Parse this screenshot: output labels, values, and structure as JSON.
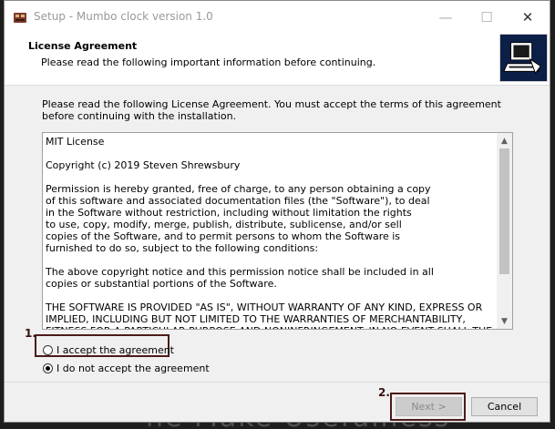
{
  "window": {
    "title": "Setup - Mumbo clock version 1.0",
    "minimize_glyph": "—",
    "maximize_glyph": "☐",
    "close_glyph": "✕"
  },
  "header": {
    "title": "License Agreement",
    "subtitle": "Please read the following important information before continuing."
  },
  "body": {
    "intro": "Please read the following License Agreement. You must accept the terms of this agreement before continuing with the installation.",
    "license_text": "MIT License\n\nCopyright (c) 2019 Steven Shrewsbury\n\nPermission is hereby granted, free of charge, to any person obtaining a copy\nof this software and associated documentation files (the \"Software\"), to deal\nin the Software without restriction, including without limitation the rights\nto use, copy, modify, merge, publish, distribute, sublicense, and/or sell\ncopies of the Software, and to permit persons to whom the Software is\nfurnished to do so, subject to the following conditions:\n\nThe above copyright notice and this permission notice shall be included in all\ncopies or substantial portions of the Software.\n\nTHE SOFTWARE IS PROVIDED \"AS IS\", WITHOUT WARRANTY OF ANY KIND, EXPRESS OR\nIMPLIED, INCLUDING BUT NOT LIMITED TO THE WARRANTIES OF MERCHANTABILITY,\nFITNESS FOR A PARTICULAR PURPOSE AND NONINFRINGEMENT. IN NO EVENT SHALL THE",
    "scroll_up_glyph": "▲",
    "scroll_down_glyph": "▼"
  },
  "options": {
    "accept_label": "I accept the agreement",
    "decline_label": "I do not accept the agreement",
    "selected": "decline"
  },
  "footer": {
    "next_label": "Next >",
    "next_enabled": false,
    "cancel_label": "Cancel"
  },
  "annotations": {
    "label_1": "1.",
    "label_2": "2.",
    "highlight_color": "#4d1a1a"
  },
  "watermark": "ne Make Usefulness"
}
